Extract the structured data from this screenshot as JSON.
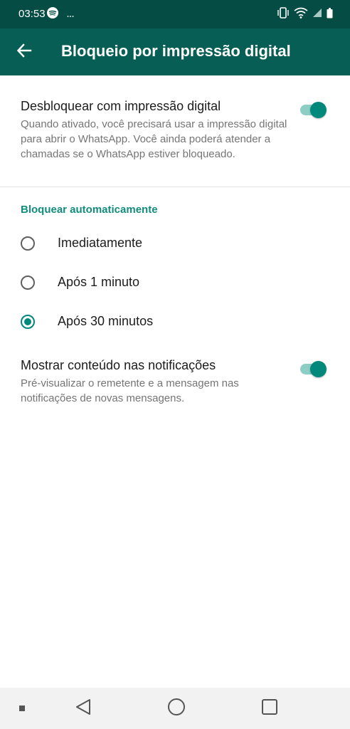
{
  "status_bar": {
    "time": "03:53",
    "background": "#054d44",
    "icons_left": [
      "spotify-icon",
      "more-notifications-icon"
    ],
    "icons_right": [
      "vibrate-icon",
      "wifi-icon",
      "signal-icon",
      "battery-icon"
    ]
  },
  "app_bar": {
    "title": "Bloqueio por impressão digital",
    "background": "#075e54",
    "back_icon": "arrow-back-icon"
  },
  "fingerprint_unlock": {
    "title": "Desbloquear com impressão digital",
    "description": "Quando ativado, você precisará usar a impressão digital para abrir o WhatsApp. Você ainda poderá atender a chamadas se o WhatsApp estiver bloqueado.",
    "enabled": true
  },
  "auto_lock": {
    "header": "Bloquear automaticamente",
    "options": [
      {
        "label": "Imediatamente",
        "selected": false
      },
      {
        "label": "Após 1 minuto",
        "selected": false
      },
      {
        "label": "Após 30 minutos",
        "selected": true
      }
    ]
  },
  "show_content": {
    "title": "Mostrar conteúdo nas notificações",
    "description": "Pré-visualizar o remetente e a mensagem nas notificações de novas mensagens.",
    "enabled": true
  },
  "colors": {
    "accent": "#00897b",
    "section_header": "#128c7e",
    "toggle_track": "#8ccdc4"
  },
  "nav_bar": {
    "icons": [
      "menu-dot-icon",
      "back-triangle-icon",
      "home-circle-icon",
      "recents-square-icon"
    ]
  }
}
